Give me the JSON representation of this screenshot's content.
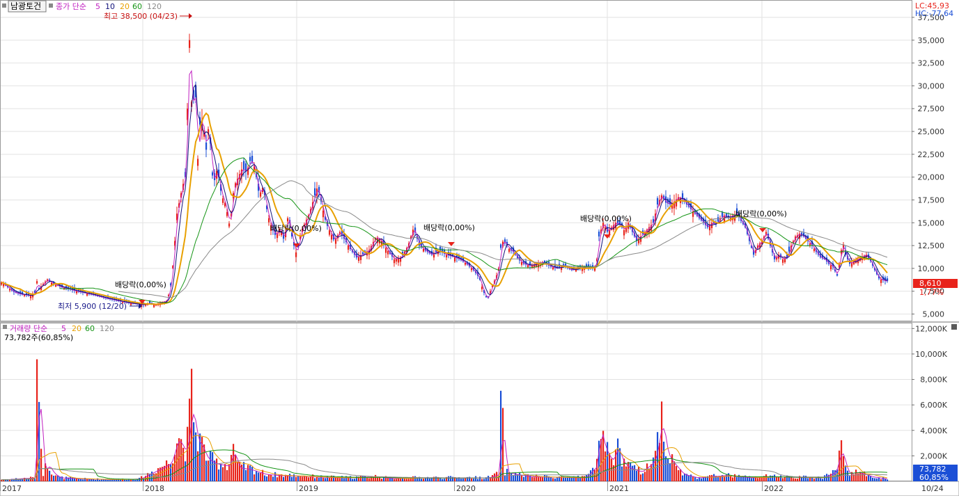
{
  "legend": {
    "stock_name": "남광토건",
    "price_label": "종가 단순",
    "ma_periods": [
      "5",
      "10",
      "20",
      "60",
      "120"
    ],
    "volume_label": "거래량 단순",
    "volume_current": "73,782주(60,85%)"
  },
  "indicators": {
    "lc": "LC:45,93",
    "hc": "HC:-77,64"
  },
  "annotations": {
    "high": "최고 38,500 (04/23)",
    "low": "최저 5,900 (12/20)",
    "dividend": "배당락(0,00%)"
  },
  "badges": {
    "price": "8,610",
    "change": "1,77%",
    "volume": "73,782",
    "volume_pct": "60,85%"
  },
  "colors": {
    "up": "#e8231b",
    "down": "#1b4fd6",
    "ma5": "#c020c0",
    "ma10": "#10107a",
    "ma20": "#e8a000",
    "ma60": "#159415",
    "ma120": "#8a8a8a"
  },
  "chart_data": {
    "type": "candlestick",
    "price_axis": {
      "ticks": [
        "37,500",
        "35,000",
        "32,500",
        "30,000",
        "27,500",
        "25,000",
        "22,500",
        "20,000",
        "17,500",
        "15,000",
        "12,500",
        "10,000",
        "7,500",
        "5,000"
      ],
      "range": [
        4200,
        39400
      ]
    },
    "volume_axis": {
      "ticks": [
        "12,000K",
        "10,000K",
        "8,000K",
        "6,000K",
        "4,000K",
        "2,000K"
      ],
      "range": [
        0,
        12400
      ]
    },
    "x_axis": {
      "labels": [
        "2017",
        "2018",
        "2019",
        "2020",
        "2021",
        "2022",
        "10/24"
      ]
    },
    "price_anchors": [
      [
        0,
        8600
      ],
      [
        10,
        8000
      ],
      [
        20,
        7400
      ],
      [
        28,
        7200
      ],
      [
        36,
        7100
      ],
      [
        44,
        7000
      ],
      [
        50,
        7300
      ],
      [
        52,
        8900
      ],
      [
        56,
        7700
      ],
      [
        62,
        8300
      ],
      [
        68,
        8800
      ],
      [
        76,
        8300
      ],
      [
        90,
        7900
      ],
      [
        100,
        7700
      ],
      [
        110,
        7500
      ],
      [
        122,
        7300
      ],
      [
        134,
        7100
      ],
      [
        148,
        6800
      ],
      [
        160,
        6600
      ],
      [
        172,
        6400
      ],
      [
        186,
        6200
      ],
      [
        196,
        6100
      ],
      [
        206,
        6000
      ],
      [
        214,
        6200
      ],
      [
        222,
        6000
      ],
      [
        232,
        6300
      ],
      [
        240,
        6400
      ],
      [
        246,
        8500
      ],
      [
        250,
        12000
      ],
      [
        254,
        16000
      ],
      [
        258,
        17500
      ],
      [
        262,
        19000
      ],
      [
        266,
        20000
      ],
      [
        272,
        35000
      ],
      [
        276,
        26000
      ],
      [
        280,
        31000
      ],
      [
        284,
        22000
      ],
      [
        288,
        27000
      ],
      [
        292,
        25500
      ],
      [
        296,
        23000
      ],
      [
        300,
        26000
      ],
      [
        306,
        19000
      ],
      [
        312,
        21000
      ],
      [
        318,
        18000
      ],
      [
        324,
        17000
      ],
      [
        330,
        14500
      ],
      [
        336,
        19000
      ],
      [
        342,
        20000
      ],
      [
        348,
        21000
      ],
      [
        354,
        20500
      ],
      [
        360,
        22000
      ],
      [
        366,
        21000
      ],
      [
        372,
        18000
      ],
      [
        378,
        19000
      ],
      [
        384,
        16000
      ],
      [
        390,
        14500
      ],
      [
        396,
        13500
      ],
      [
        402,
        14500
      ],
      [
        408,
        13000
      ],
      [
        414,
        16000
      ],
      [
        420,
        13000
      ],
      [
        426,
        11500
      ],
      [
        432,
        14000
      ],
      [
        438,
        15000
      ],
      [
        444,
        16000
      ],
      [
        450,
        17500
      ],
      [
        456,
        19000
      ],
      [
        462,
        17000
      ],
      [
        468,
        15000
      ],
      [
        474,
        14000
      ],
      [
        480,
        13000
      ],
      [
        488,
        14000
      ],
      [
        496,
        13000
      ],
      [
        504,
        12000
      ],
      [
        512,
        11200
      ],
      [
        520,
        11500
      ],
      [
        530,
        12000
      ],
      [
        540,
        13500
      ],
      [
        548,
        13000
      ],
      [
        556,
        12000
      ],
      [
        566,
        11000
      ],
      [
        576,
        11200
      ],
      [
        586,
        12500
      ],
      [
        594,
        14500
      ],
      [
        602,
        12500
      ],
      [
        610,
        12000
      ],
      [
        620,
        11500
      ],
      [
        630,
        12000
      ],
      [
        640,
        11500
      ],
      [
        650,
        11300
      ],
      [
        660,
        11000
      ],
      [
        670,
        10500
      ],
      [
        680,
        9800
      ],
      [
        688,
        9000
      ],
      [
        694,
        7500
      ],
      [
        700,
        6500
      ],
      [
        706,
        8000
      ],
      [
        712,
        9000
      ],
      [
        716,
        10000
      ],
      [
        720,
        13000
      ],
      [
        726,
        12800
      ],
      [
        732,
        12000
      ],
      [
        738,
        11800
      ],
      [
        744,
        11000
      ],
      [
        752,
        10500
      ],
      [
        760,
        10300
      ],
      [
        770,
        10500
      ],
      [
        780,
        10700
      ],
      [
        790,
        10200
      ],
      [
        800,
        10000
      ],
      [
        810,
        10300
      ],
      [
        820,
        9800
      ],
      [
        830,
        10000
      ],
      [
        840,
        10200
      ],
      [
        850,
        10000
      ],
      [
        856,
        10200
      ],
      [
        860,
        13500
      ],
      [
        866,
        15000
      ],
      [
        872,
        14000
      ],
      [
        878,
        14500
      ],
      [
        884,
        15000
      ],
      [
        890,
        14800
      ],
      [
        896,
        14200
      ],
      [
        902,
        15000
      ],
      [
        908,
        14000
      ],
      [
        914,
        13000
      ],
      [
        920,
        13500
      ],
      [
        926,
        14000
      ],
      [
        932,
        14500
      ],
      [
        938,
        15000
      ],
      [
        944,
        17000
      ],
      [
        950,
        18000
      ],
      [
        956,
        17200
      ],
      [
        962,
        17000
      ],
      [
        968,
        17300
      ],
      [
        974,
        17800
      ],
      [
        980,
        17600
      ],
      [
        986,
        17000
      ],
      [
        992,
        16500
      ],
      [
        998,
        16000
      ],
      [
        1004,
        15500
      ],
      [
        1010,
        15000
      ],
      [
        1016,
        14500
      ],
      [
        1022,
        15000
      ],
      [
        1028,
        14800
      ],
      [
        1034,
        15500
      ],
      [
        1040,
        15800
      ],
      [
        1046,
        15500
      ],
      [
        1052,
        15800
      ],
      [
        1058,
        16000
      ],
      [
        1064,
        15200
      ],
      [
        1070,
        14500
      ],
      [
        1076,
        13000
      ],
      [
        1082,
        11500
      ],
      [
        1088,
        12500
      ],
      [
        1094,
        13000
      ],
      [
        1100,
        14000
      ],
      [
        1106,
        12500
      ],
      [
        1112,
        11000
      ],
      [
        1118,
        11500
      ],
      [
        1124,
        11000
      ],
      [
        1130,
        11200
      ],
      [
        1136,
        12500
      ],
      [
        1142,
        13500
      ],
      [
        1148,
        13800
      ],
      [
        1154,
        13500
      ],
      [
        1160,
        13000
      ],
      [
        1166,
        12500
      ],
      [
        1172,
        11800
      ],
      [
        1178,
        11200
      ],
      [
        1184,
        11000
      ],
      [
        1190,
        10500
      ],
      [
        1196,
        10200
      ],
      [
        1202,
        9200
      ],
      [
        1206,
        11000
      ],
      [
        1210,
        13000
      ],
      [
        1214,
        11500
      ],
      [
        1220,
        10500
      ],
      [
        1226,
        10800
      ],
      [
        1232,
        11000
      ],
      [
        1238,
        11300
      ],
      [
        1244,
        11500
      ],
      [
        1250,
        10800
      ],
      [
        1256,
        9800
      ],
      [
        1262,
        8900
      ],
      [
        1268,
        8700
      ],
      [
        1272,
        8600
      ],
      [
        1276,
        8610
      ]
    ],
    "volume_anchors": [
      [
        0,
        120
      ],
      [
        50,
        300
      ],
      [
        55,
        11500
      ],
      [
        60,
        400
      ],
      [
        68,
        1500
      ],
      [
        75,
        700
      ],
      [
        85,
        300
      ],
      [
        120,
        200
      ],
      [
        160,
        150
      ],
      [
        200,
        200
      ],
      [
        246,
        1600
      ],
      [
        250,
        3000
      ],
      [
        256,
        3800
      ],
      [
        262,
        2800
      ],
      [
        268,
        2500
      ],
      [
        272,
        5100
      ],
      [
        276,
        7400
      ],
      [
        280,
        3700
      ],
      [
        284,
        3500
      ],
      [
        290,
        3000
      ],
      [
        294,
        2200
      ],
      [
        300,
        1800
      ],
      [
        310,
        1500
      ],
      [
        320,
        1400
      ],
      [
        330,
        1300
      ],
      [
        334,
        3200
      ],
      [
        340,
        1200
      ],
      [
        350,
        1100
      ],
      [
        360,
        1000
      ],
      [
        370,
        800
      ],
      [
        380,
        600
      ],
      [
        400,
        500
      ],
      [
        430,
        450
      ],
      [
        460,
        350
      ],
      [
        500,
        300
      ],
      [
        540,
        400
      ],
      [
        560,
        250
      ],
      [
        600,
        300
      ],
      [
        650,
        300
      ],
      [
        700,
        300
      ],
      [
        716,
        600
      ],
      [
        720,
        7500
      ],
      [
        724,
        800
      ],
      [
        740,
        600
      ],
      [
        760,
        400
      ],
      [
        800,
        350
      ],
      [
        840,
        300
      ],
      [
        858,
        1500
      ],
      [
        860,
        5000
      ],
      [
        864,
        3600
      ],
      [
        870,
        2500
      ],
      [
        880,
        1600
      ],
      [
        886,
        3500
      ],
      [
        890,
        2000
      ],
      [
        900,
        1200
      ],
      [
        920,
        800
      ],
      [
        940,
        1800
      ],
      [
        950,
        5600
      ],
      [
        954,
        3100
      ],
      [
        960,
        2000
      ],
      [
        980,
        600
      ],
      [
        1000,
        300
      ],
      [
        1040,
        500
      ],
      [
        1080,
        300
      ],
      [
        1100,
        400
      ],
      [
        1140,
        350
      ],
      [
        1180,
        300
      ],
      [
        1200,
        800
      ],
      [
        1206,
        3000
      ],
      [
        1210,
        2200
      ],
      [
        1216,
        600
      ],
      [
        1230,
        800
      ],
      [
        1250,
        400
      ],
      [
        1272,
        200
      ],
      [
        1276,
        74
      ]
    ],
    "series": [
      {
        "name": "5",
        "kind": "sma"
      },
      {
        "name": "10",
        "kind": "sma"
      },
      {
        "name": "20",
        "kind": "sma"
      },
      {
        "name": "60",
        "kind": "sma"
      },
      {
        "name": "120",
        "kind": "sma"
      }
    ]
  }
}
